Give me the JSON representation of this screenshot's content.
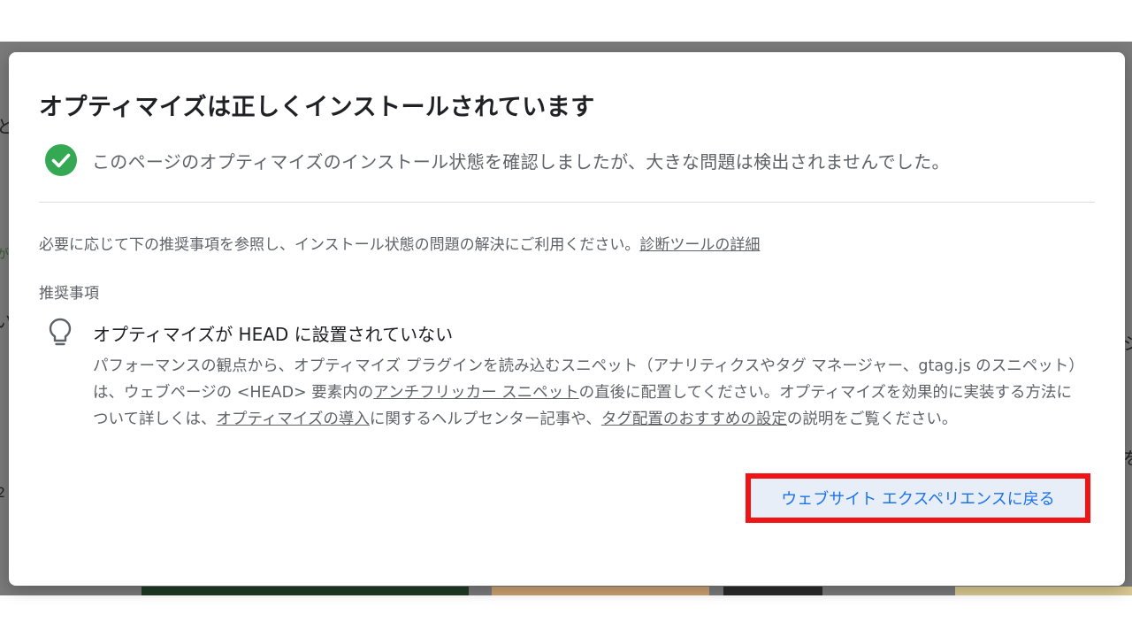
{
  "dialog": {
    "title": "オプティマイズは正しくインストールされています",
    "status_text": "このページのオプティマイズのインストール状態を確認しましたが、大きな問題は検出されませんでした。",
    "intro_text": "必要に応じて下の推奨事項を参照し、インストール状態の問題の解決にご利用ください。",
    "intro_link": "診断ツールの詳細",
    "section_label": "推奨事項",
    "recommendation": {
      "title": "オプティマイズが HEAD に設置されていない",
      "body_part1": "パフォーマンスの観点から、オプティマイズ プラグインを読み込むスニペット（アナリティクスやタグ マネージャー、gtag.js のスニペット）は、ウェブページの <HEAD> 要素内の",
      "link1": "アンチフリッカー スニペット",
      "body_part2": "の直後に配置してください。オプティマイズを効果的に実装する方法について詳しくは、",
      "link2": "オプティマイズの導入",
      "body_part3": "に関するヘルプセンター記事や、",
      "link3": "タグ配置のおすすめの設定",
      "body_part4": "の説明をご覧ください。"
    },
    "back_button": "ウェブサイト エクスペリエンスに戻る"
  },
  "background": {
    "glyphs": [
      "と",
      "が",
      "い",
      "ジ",
      "2",
      "を"
    ]
  },
  "colors": {
    "check": "#34a853",
    "accent": "#1a73e8",
    "highlight_border": "#f01414",
    "button_bg": "#e8eef7"
  },
  "icons": {
    "status": "check-circle-icon",
    "recommendation": "lightbulb-icon"
  }
}
